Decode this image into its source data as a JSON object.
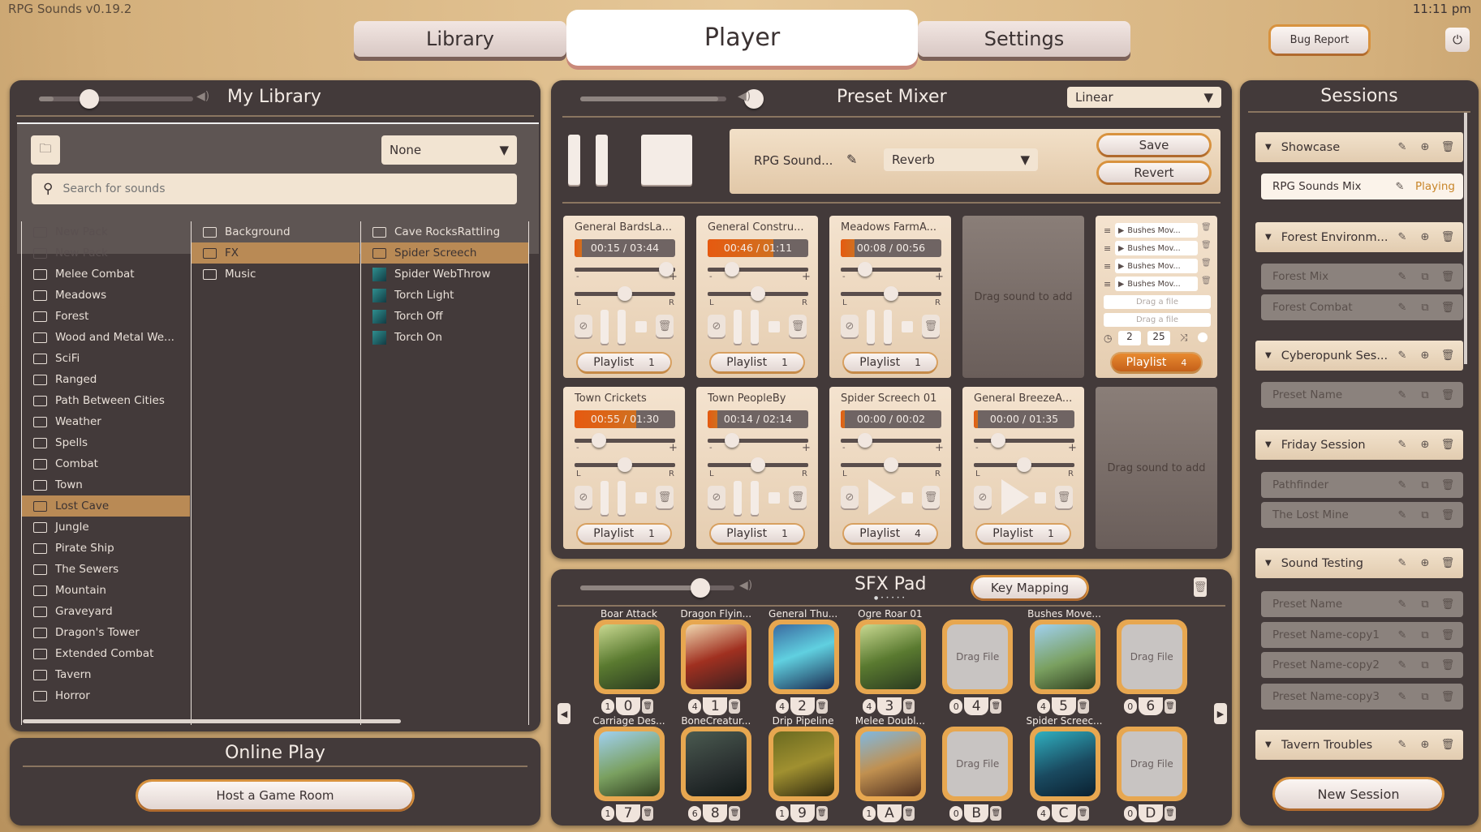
{
  "app": {
    "version": "RPG Sounds v0.19.2",
    "clock": "11:11 pm",
    "bug_report": "Bug Report",
    "power_icon": "power-icon"
  },
  "tabs": [
    {
      "label": "Library"
    },
    {
      "label": "Player",
      "active": true
    },
    {
      "label": "Settings"
    }
  ],
  "library": {
    "title": "My Library",
    "filter": "None",
    "search_placeholder": "Search for sounds",
    "volume": 0.1,
    "packs": [
      {
        "label": "New Pack",
        "dim": true
      },
      {
        "label": "New Pack",
        "dim": true
      },
      {
        "label": "Melee Combat"
      },
      {
        "label": "Meadows"
      },
      {
        "label": "Forest"
      },
      {
        "label": "Wood and Metal We..."
      },
      {
        "label": "SciFi"
      },
      {
        "label": "Ranged"
      },
      {
        "label": "Path Between Cities"
      },
      {
        "label": "Weather"
      },
      {
        "label": "Spells"
      },
      {
        "label": "Combat"
      },
      {
        "label": "Town"
      },
      {
        "label": "Lost Cave",
        "selected": true
      },
      {
        "label": "Jungle"
      },
      {
        "label": "Pirate Ship"
      },
      {
        "label": "The Sewers"
      },
      {
        "label": "Mountain"
      },
      {
        "label": "Graveyard"
      },
      {
        "label": "Dragon's Tower"
      },
      {
        "label": "Extended Combat"
      },
      {
        "label": "Tavern"
      },
      {
        "label": "Horror"
      }
    ],
    "folders": [
      {
        "label": "Background"
      },
      {
        "label": "FX",
        "selected": true
      },
      {
        "label": "Music"
      }
    ],
    "sounds": [
      {
        "label": "Cave RocksRattling",
        "type": "folder"
      },
      {
        "label": "Spider Screech",
        "type": "folder",
        "selected": true
      },
      {
        "label": "Spider WebThrow",
        "type": "sound"
      },
      {
        "label": "Torch Light",
        "type": "sound"
      },
      {
        "label": "Torch Off",
        "type": "sound"
      },
      {
        "label": "Torch On",
        "type": "sound"
      }
    ]
  },
  "online": {
    "title": "Online Play",
    "host_button": "Host a Game Room"
  },
  "mixer": {
    "title": "Preset Mixer",
    "volume": 0.9,
    "fade_mode": "Linear",
    "preset_name": "RPG Sound...",
    "effect": "Reverb",
    "save": "Save",
    "revert": "Revert",
    "drag_sound": "Drag sound to add",
    "cards": [
      {
        "name": "General BardsLa...",
        "time": "00:15 / 03:44",
        "progress": 0.07,
        "volume": 0.98,
        "pan": 0.5,
        "playing": true,
        "playlist": "Playlist",
        "count": "1"
      },
      {
        "name": "General Constru...",
        "time": "00:46 / 01:11",
        "progress": 0.65,
        "volume": 0.2,
        "pan": 0.5,
        "playing": true,
        "playlist": "Playlist",
        "count": "1"
      },
      {
        "name": "Meadows FarmA...",
        "time": "00:08 / 00:56",
        "progress": 0.14,
        "volume": 0.2,
        "pan": 0.5,
        "playing": true,
        "playlist": "Playlist",
        "count": "1"
      },
      null,
      {
        "type": "playlist",
        "items": [
          "Bushes Mov...",
          "Bushes Mov...",
          "Bushes Mov...",
          "Bushes Mov..."
        ],
        "drag_file": "Drag a file",
        "delay_min": "2",
        "delay_max": "25",
        "playlist": "Playlist",
        "count": "4"
      },
      {
        "name": "Town Crickets",
        "time": "00:55 / 01:30",
        "progress": 0.61,
        "volume": 0.2,
        "pan": 0.5,
        "playing": true,
        "playlist": "Playlist",
        "count": "1"
      },
      {
        "name": "Town PeopleBy",
        "time": "00:14 / 02:14",
        "progress": 0.1,
        "volume": 0.2,
        "pan": 0.5,
        "playing": true,
        "playlist": "Playlist",
        "count": "1"
      },
      {
        "name": "Spider Screech 01",
        "time": "00:00 / 00:02",
        "progress": 0,
        "volume": 0.2,
        "pan": 0.5,
        "playing": false,
        "playlist": "Playlist",
        "count": "4"
      },
      {
        "name": "General BreezeA...",
        "time": "00:00 / 01:35",
        "progress": 0,
        "volume": 0.2,
        "pan": 0.5,
        "playing": false,
        "playlist": "Playlist",
        "count": "1"
      },
      null
    ]
  },
  "sfx": {
    "title": "SFX Pad",
    "key_mapping": "Key Mapping",
    "volume": 0.75,
    "drag_file": "Drag File",
    "pads": [
      {
        "name": "Boar Attack",
        "count": "1",
        "key": "0",
        "art": "forest"
      },
      {
        "name": "Dragon Flyin...",
        "count": "4",
        "key": "1",
        "art": "dragon"
      },
      {
        "name": "General Thu...",
        "count": "4",
        "key": "2",
        "art": "storm"
      },
      {
        "name": "Ogre Roar 01",
        "count": "4",
        "key": "3",
        "art": "forest"
      },
      {
        "name": "",
        "count": "0",
        "key": "4"
      },
      {
        "name": "Bushes Move...",
        "count": "4",
        "key": "5",
        "art": "castle"
      },
      {
        "name": "",
        "count": "0",
        "key": "6"
      },
      {
        "name": "Carriage Des...",
        "count": "1",
        "key": "7",
        "art": "castle"
      },
      {
        "name": "BoneCreatur...",
        "count": "6",
        "key": "8",
        "art": "dark"
      },
      {
        "name": "Drip Pipeline",
        "count": "1",
        "key": "9",
        "art": "serpent"
      },
      {
        "name": "Melee Doubl...",
        "count": "1",
        "key": "A",
        "art": "warrior"
      },
      {
        "name": "",
        "count": "0",
        "key": "B"
      },
      {
        "name": "Spider Screec...",
        "count": "4",
        "key": "C",
        "art": "spider"
      },
      {
        "name": "",
        "count": "0",
        "key": "D"
      }
    ]
  },
  "sessions": {
    "title": "Sessions",
    "new_session": "New Session",
    "playing_label": "Playing",
    "groups": [
      {
        "name": "Showcase",
        "presets": [
          {
            "name": "RPG Sounds Mix",
            "playing": true
          }
        ]
      },
      {
        "name": "Forest Environm...",
        "presets": [
          {
            "name": "Forest Mix"
          },
          {
            "name": "Forest Combat"
          }
        ]
      },
      {
        "name": "Cyberopunk Ses...",
        "presets": [
          {
            "name": "Preset Name"
          }
        ]
      },
      {
        "name": "Friday Session",
        "presets": [
          {
            "name": "Pathfinder"
          },
          {
            "name": "The Lost Mine"
          }
        ]
      },
      {
        "name": "Sound Testing",
        "presets": [
          {
            "name": "Preset Name"
          },
          {
            "name": "Preset Name-copy1"
          },
          {
            "name": "Preset Name-copy2"
          },
          {
            "name": "Preset Name-copy3"
          }
        ]
      },
      {
        "name": "Tavern Troubles",
        "presets": []
      }
    ]
  },
  "colors": {
    "accent": "#e06a1a",
    "panel": "#433a3a",
    "card": "#efdcc5",
    "selected": "#b98a55"
  }
}
